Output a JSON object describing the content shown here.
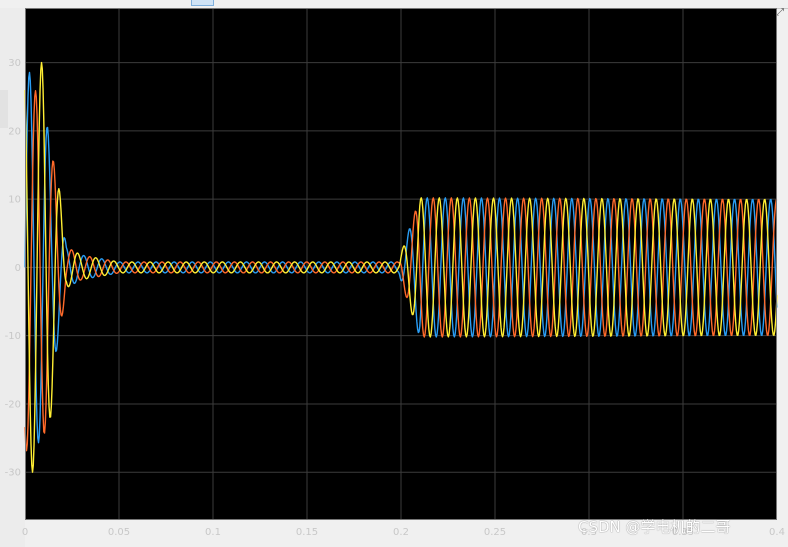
{
  "window": {
    "corner_icon": "arrow-icon"
  },
  "colors": {
    "background": "#000000",
    "grid": "#3c3c3c",
    "axis": "#c8c8c8",
    "series": [
      "#2a9df4",
      "#ff6a2a",
      "#ffee33"
    ]
  },
  "watermark": "CSDN @学电机的二哥",
  "chart_data": {
    "type": "line",
    "title": "",
    "xlabel": "",
    "ylabel": "",
    "xlim": [
      0,
      0.4
    ],
    "ylim": [
      -37,
      38
    ],
    "grid": true,
    "legend": "none",
    "xticks": [
      0,
      0.05,
      0.1,
      0.15,
      0.2,
      0.25,
      0.3,
      0.35,
      0.4
    ],
    "xtick_labels": [
      "0",
      "0.05",
      "0.1",
      "0.15",
      "0.2",
      "0.25",
      "0.3",
      "0.35",
      "0.4"
    ],
    "yticks": [
      -30,
      -20,
      -10,
      0,
      10,
      20,
      30
    ],
    "ytick_labels": [
      "-30",
      "-20",
      "-10",
      "0",
      "10",
      "20",
      "30"
    ],
    "sample_step": 0.0004,
    "series": [
      {
        "phase_deg": 0,
        "color": "#2a9df4",
        "envelope": {
          "t": [
            0,
            0.01,
            0.022,
            0.03,
            0.05,
            0.199,
            0.2,
            0.21,
            0.4
          ],
          "amplitude": [
            30,
            24,
            3,
            1.8,
            0.8,
            0.8,
            2,
            10.2,
            10
          ]
        }
      },
      {
        "phase_deg": -120,
        "color": "#ff6a2a",
        "envelope": {
          "t": [
            0,
            0.01,
            0.022,
            0.03,
            0.05,
            0.199,
            0.2,
            0.21,
            0.4
          ],
          "amplitude": [
            27,
            25,
            3,
            1.8,
            0.8,
            0.8,
            2,
            10.2,
            10
          ]
        }
      },
      {
        "phase_deg": 120,
        "color": "#ffee33",
        "envelope": {
          "t": [
            0,
            0.01,
            0.022,
            0.03,
            0.05,
            0.199,
            0.2,
            0.21,
            0.4
          ],
          "amplitude": [
            30,
            30,
            3,
            1.8,
            0.8,
            0.8,
            2,
            10.2,
            10
          ]
        }
      }
    ],
    "frequency_hz": 104
  }
}
